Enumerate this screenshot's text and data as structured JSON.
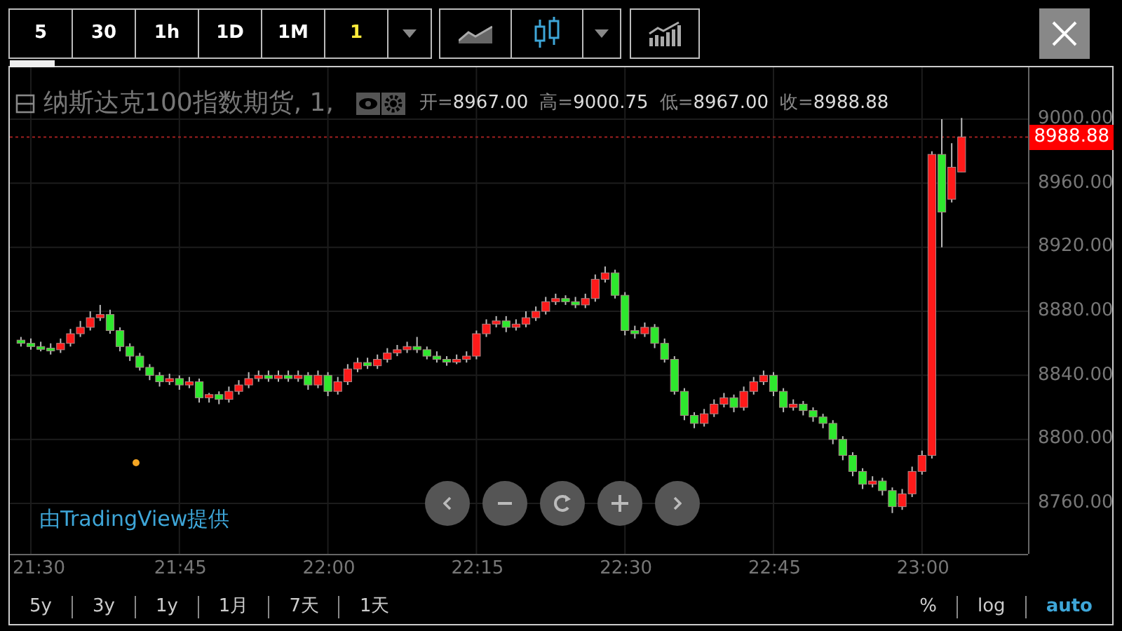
{
  "toolbar": {
    "intervals": [
      {
        "label": "5",
        "selected": false
      },
      {
        "label": "30",
        "selected": false
      },
      {
        "label": "1h",
        "selected": false
      },
      {
        "label": "1D",
        "selected": false
      },
      {
        "label": "1M",
        "selected": false
      },
      {
        "label": "1",
        "selected": true
      }
    ],
    "chart_types": [
      {
        "kind": "line",
        "selected": false
      },
      {
        "kind": "candles",
        "selected": true
      }
    ]
  },
  "legend": {
    "title": "纳斯达克100指数期货, 1,",
    "ohlc": [
      {
        "label": "开=",
        "value": "8967.00"
      },
      {
        "label": "高=",
        "value": "9000.75"
      },
      {
        "label": "低=",
        "value": "8967.00"
      },
      {
        "label": "收=",
        "value": "8988.88"
      }
    ]
  },
  "chart_data": {
    "type": "candlestick",
    "categories": [
      null,
      "21:30",
      null,
      null,
      null,
      null,
      null,
      null,
      null,
      null,
      null,
      null,
      null,
      null,
      null,
      null,
      "21:45",
      null,
      null,
      null,
      null,
      null,
      null,
      null,
      null,
      null,
      null,
      null,
      null,
      null,
      null,
      "22:00",
      null,
      null,
      null,
      null,
      null,
      null,
      null,
      null,
      null,
      null,
      null,
      null,
      null,
      null,
      "22:15",
      null,
      null,
      null,
      null,
      null,
      null,
      null,
      null,
      null,
      null,
      null,
      null,
      null,
      null,
      "22:30",
      null,
      null,
      null,
      null,
      null,
      null,
      null,
      null,
      null,
      null,
      null,
      null,
      null,
      null,
      "22:45",
      null,
      null,
      null,
      null,
      null,
      null,
      null,
      null,
      null,
      null,
      null,
      null,
      null,
      null,
      "23:00",
      null,
      null,
      null,
      null
    ],
    "ylim": [
      8728.5,
      9032.4
    ],
    "grid": true,
    "ref_lines": [
      {
        "axis": "y",
        "value": 8988.88,
        "label": "8988.88"
      }
    ],
    "ohlc": [
      [
        8862,
        8864,
        8858,
        8860
      ],
      [
        8860,
        8863,
        8856,
        8858
      ],
      [
        8858,
        8861,
        8855,
        8857
      ],
      [
        8857,
        8860,
        8853,
        8856
      ],
      [
        8856,
        8863,
        8854,
        8860
      ],
      [
        8860,
        8869,
        8858,
        8866
      ],
      [
        8866,
        8874,
        8864,
        8870
      ],
      [
        8870,
        8880,
        8868,
        8876
      ],
      [
        8876,
        8884,
        8874,
        8878
      ],
      [
        8878,
        8881,
        8866,
        8868
      ],
      [
        8868,
        8870,
        8855,
        8858
      ],
      [
        8858,
        8860,
        8849,
        8852
      ],
      [
        8852,
        8854,
        8843,
        8845
      ],
      [
        8845,
        8847,
        8837,
        8840
      ],
      [
        8840,
        8842,
        8833,
        8836
      ],
      [
        8836,
        8841,
        8834,
        8838
      ],
      [
        8838,
        8840,
        8831,
        8834
      ],
      [
        8834,
        8839,
        8832,
        8836
      ],
      [
        8836,
        8838,
        8823,
        8826
      ],
      [
        8826,
        8829,
        8823,
        8828
      ],
      [
        8828,
        8830,
        8822,
        8825
      ],
      [
        8825,
        8833,
        8823,
        8830
      ],
      [
        8830,
        8837,
        8828,
        8834
      ],
      [
        8834,
        8842,
        8832,
        8838
      ],
      [
        8838,
        8843,
        8836,
        8840
      ],
      [
        8840,
        8843,
        8836,
        8838
      ],
      [
        8838,
        8843,
        8836,
        8840
      ],
      [
        8840,
        8843,
        8836,
        8838
      ],
      [
        8838,
        8843,
        8836,
        8840
      ],
      [
        8840,
        8842,
        8831,
        8834
      ],
      [
        8834,
        8843,
        8832,
        8840
      ],
      [
        8840,
        8842,
        8827,
        8830
      ],
      [
        8830,
        8839,
        8828,
        8836
      ],
      [
        8836,
        8847,
        8834,
        8844
      ],
      [
        8844,
        8851,
        8842,
        8848
      ],
      [
        8848,
        8851,
        8844,
        8846
      ],
      [
        8846,
        8853,
        8844,
        8850
      ],
      [
        8850,
        8857,
        8848,
        8854
      ],
      [
        8854,
        8859,
        8852,
        8856
      ],
      [
        8856,
        8861,
        8854,
        8858
      ],
      [
        8858,
        8864,
        8854,
        8856
      ],
      [
        8856,
        8858,
        8850,
        8852
      ],
      [
        8852,
        8855,
        8848,
        8850
      ],
      [
        8850,
        8852,
        8846,
        8849
      ],
      [
        8849,
        8853,
        8847,
        8850
      ],
      [
        8850,
        8855,
        8848,
        8852
      ],
      [
        8852,
        8868,
        8850,
        8866
      ],
      [
        8866,
        8875,
        8864,
        8872
      ],
      [
        8872,
        8877,
        8870,
        8874
      ],
      [
        8874,
        8877,
        8867,
        8870
      ],
      [
        8870,
        8875,
        8868,
        8872
      ],
      [
        8872,
        8880,
        8870,
        8876
      ],
      [
        8876,
        8883,
        8874,
        8880
      ],
      [
        8880,
        8889,
        8878,
        8886
      ],
      [
        8886,
        8891,
        8884,
        8888
      ],
      [
        8888,
        8890,
        8884,
        8886
      ],
      [
        8886,
        8889,
        8882,
        8884
      ],
      [
        8884,
        8891,
        8882,
        8888
      ],
      [
        8888,
        8903,
        8886,
        8900
      ],
      [
        8900,
        8908,
        8898,
        8904
      ],
      [
        8904,
        8906,
        8888,
        8890
      ],
      [
        8890,
        8892,
        8865,
        8868
      ],
      [
        8868,
        8871,
        8863,
        8866
      ],
      [
        8866,
        8873,
        8864,
        8870
      ],
      [
        8870,
        8872,
        8857,
        8860
      ],
      [
        8860,
        8863,
        8848,
        8850
      ],
      [
        8850,
        8852,
        8828,
        8830
      ],
      [
        8830,
        8832,
        8812,
        8815
      ],
      [
        8815,
        8817,
        8807,
        8810
      ],
      [
        8810,
        8819,
        8808,
        8816
      ],
      [
        8816,
        8825,
        8814,
        8822
      ],
      [
        8822,
        8829,
        8820,
        8826
      ],
      [
        8826,
        8828,
        8817,
        8820
      ],
      [
        8820,
        8833,
        8818,
        8830
      ],
      [
        8830,
        8839,
        8828,
        8836
      ],
      [
        8836,
        8843,
        8834,
        8840
      ],
      [
        8840,
        8842,
        8827,
        8830
      ],
      [
        8830,
        8832,
        8817,
        8820
      ],
      [
        8820,
        8825,
        8818,
        8822
      ],
      [
        8822,
        8824,
        8815,
        8818
      ],
      [
        8818,
        8820,
        8811,
        8814
      ],
      [
        8814,
        8816,
        8807,
        8810
      ],
      [
        8810,
        8812,
        8797,
        8800
      ],
      [
        8800,
        8802,
        8787,
        8790
      ],
      [
        8790,
        8792,
        8777,
        8780
      ],
      [
        8780,
        8782,
        8769,
        8772
      ],
      [
        8772,
        8777,
        8770,
        8774
      ],
      [
        8774,
        8776,
        8765,
        8768
      ],
      [
        8768,
        8770,
        8754,
        8758
      ],
      [
        8758,
        8769,
        8756,
        8766
      ],
      [
        8766,
        8783,
        8764,
        8780
      ],
      [
        8780,
        8793,
        8778,
        8790
      ],
      [
        8790,
        8980,
        8788,
        8978
      ],
      [
        8978,
        9000,
        8920,
        8942
      ],
      [
        8950,
        8985,
        8948,
        8970
      ],
      [
        8967,
        9000.75,
        8967,
        8988.88
      ]
    ],
    "yticks": [
      {
        "value": 9000,
        "label": "9000.00"
      },
      {
        "value": 8960,
        "label": "8960.00"
      },
      {
        "value": 8920,
        "label": "8920.00"
      },
      {
        "value": 8880,
        "label": "8880.00"
      },
      {
        "value": 8840,
        "label": "8840.00"
      },
      {
        "value": 8800,
        "label": "8800.00"
      },
      {
        "value": 8760,
        "label": "8760.00"
      }
    ]
  },
  "attribution": "由TradingView提供",
  "ranges": [
    {
      "label": "5y",
      "selected": false
    },
    {
      "label": "3y",
      "selected": false
    },
    {
      "label": "1y",
      "selected": false
    },
    {
      "label": "1月",
      "selected": false
    },
    {
      "label": "7天",
      "selected": false
    },
    {
      "label": "1天",
      "selected": false
    }
  ],
  "scales": [
    {
      "label": "%",
      "selected": false
    },
    {
      "label": "log",
      "selected": false
    },
    {
      "label": "auto",
      "selected": true
    }
  ]
}
